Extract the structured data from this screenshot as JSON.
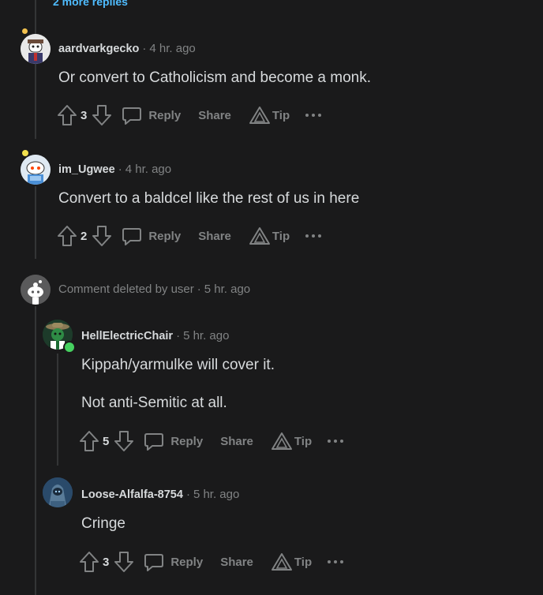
{
  "top": {
    "more_replies": "2 more replies"
  },
  "comments": [
    {
      "username": "aardvarkgecko",
      "time": "4 hr. ago",
      "body": [
        "Or convert to Catholicism and become a monk."
      ],
      "votes": "3",
      "reply": "Reply",
      "share": "Share",
      "tip": "Tip"
    },
    {
      "username": "im_Ugwee",
      "time": "4 hr. ago",
      "body": [
        "Convert to a baldcel like the rest of us in here"
      ],
      "votes": "2",
      "reply": "Reply",
      "share": "Share",
      "tip": "Tip"
    },
    {
      "deleted_text": "Comment deleted by user",
      "time": "5 hr. ago"
    },
    {
      "username": "HellElectricChair",
      "time": "5 hr. ago",
      "body": [
        "Kippah/yarmulke will cover it.",
        "Not anti-Semitic at all."
      ],
      "votes": "5",
      "reply": "Reply",
      "share": "Share",
      "tip": "Tip"
    },
    {
      "username": "Loose-Alfalfa-8754",
      "time": "5 hr. ago",
      "body": [
        "Cringe"
      ],
      "votes": "3",
      "reply": "Reply",
      "share": "Share",
      "tip": "Tip"
    }
  ],
  "colors": {
    "background": "#1a1a1b",
    "text": "#d7dadc",
    "muted": "#818384",
    "link": "#4fbcff",
    "online": "#46d160"
  }
}
